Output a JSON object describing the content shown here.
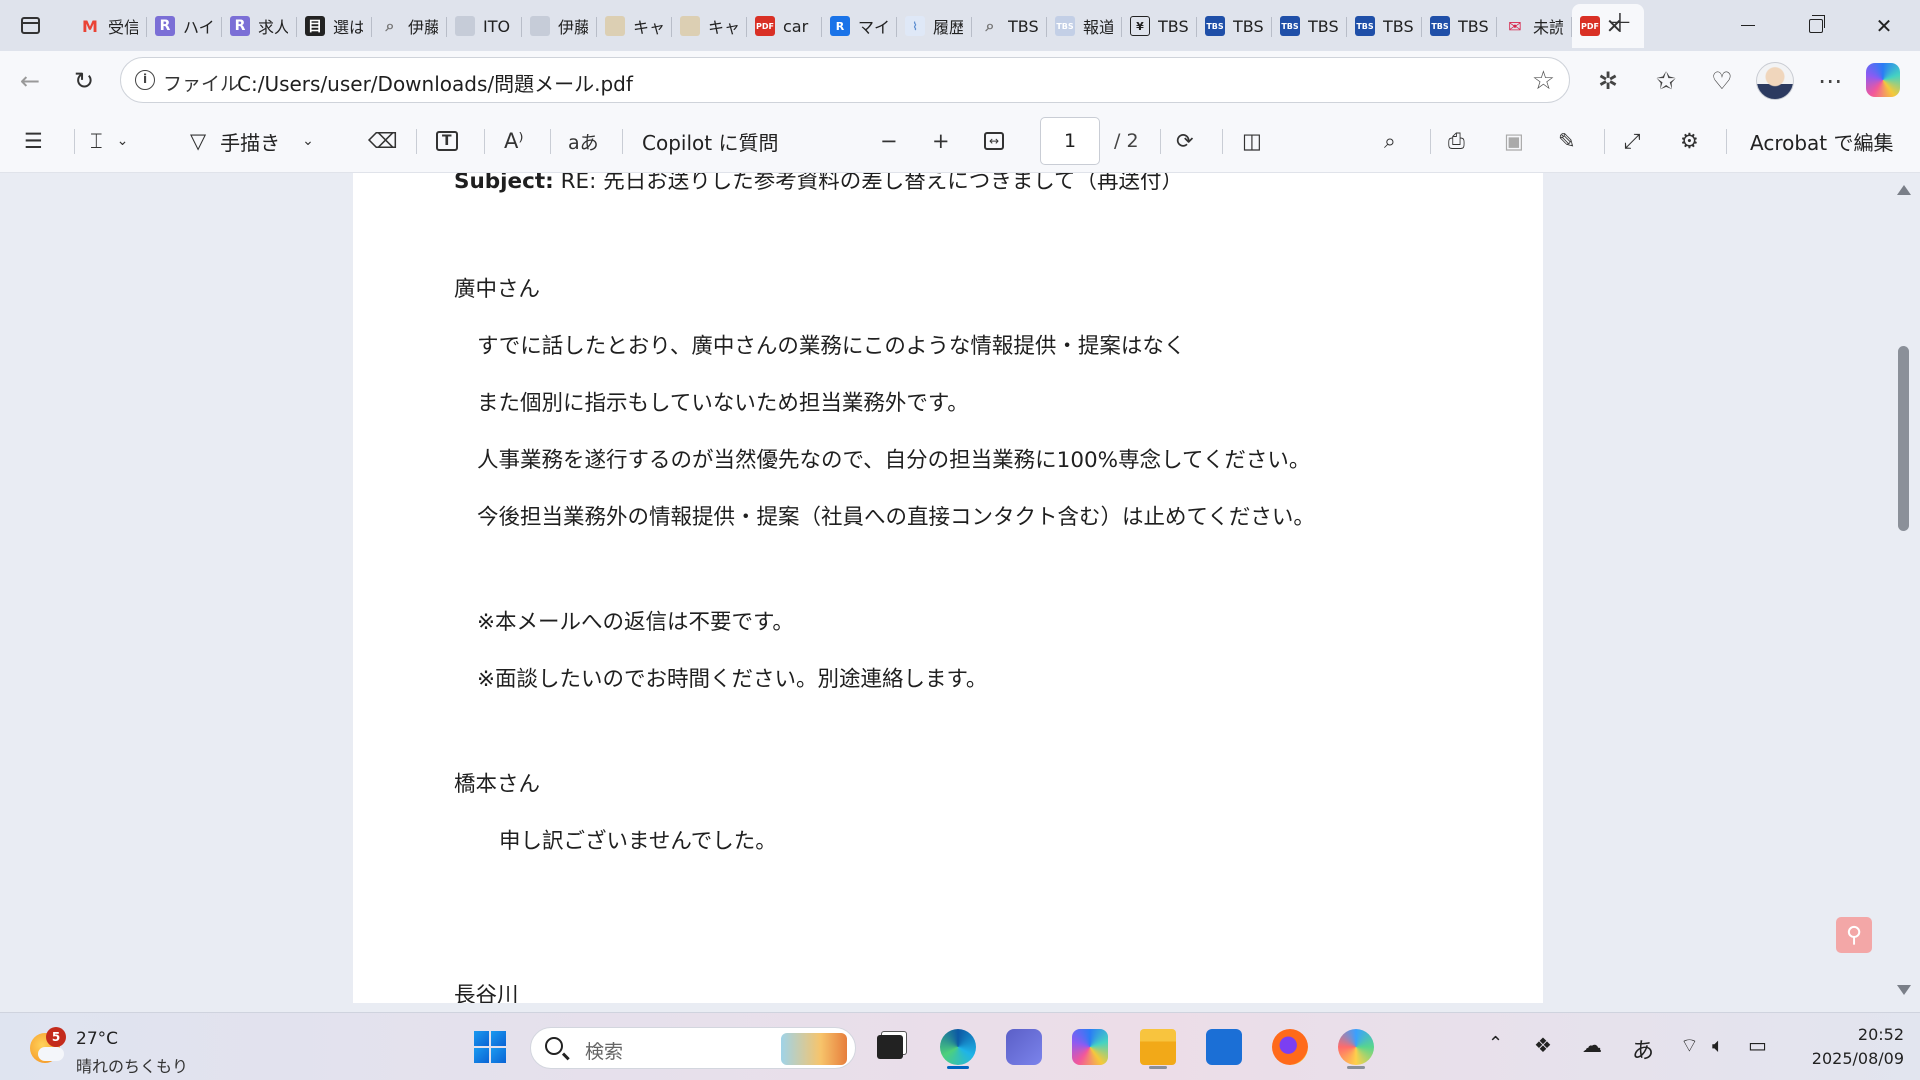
{
  "browser": {
    "tabs": [
      {
        "title": "受信",
        "icon": "gmail-icon",
        "color": "#ea4335"
      },
      {
        "title": "ハイ",
        "icon": "r-logo-icon",
        "color": "#7b6fd6"
      },
      {
        "title": "求人",
        "icon": "r-logo-icon",
        "color": "#7b6fd6"
      },
      {
        "title": "選は",
        "icon": "document-icon",
        "color": "#222222"
      },
      {
        "title": "伊藤",
        "icon": "search-icon",
        "color": "#777777"
      },
      {
        "title": "ITO",
        "icon": "site-icon",
        "color": "#9aa3b5"
      },
      {
        "title": "伊藤",
        "icon": "site-icon",
        "color": "#9aa3b5"
      },
      {
        "title": "キャ",
        "icon": "site-icon",
        "color": "#c9b48a"
      },
      {
        "title": "キャ",
        "icon": "site-icon",
        "color": "#c9b48a"
      },
      {
        "title": "car",
        "icon": "pdf-icon",
        "color": "#d93025"
      },
      {
        "title": "マイ",
        "icon": "re-logo-icon",
        "color": "#1a73e8"
      },
      {
        "title": "履歴",
        "icon": "chart-icon",
        "color": "#5f8fd1"
      },
      {
        "title": "TBS",
        "icon": "search-icon",
        "color": "#777777"
      },
      {
        "title": "報道",
        "icon": "tbs-icon",
        "color": "#9db1d8"
      },
      {
        "title": "TBS",
        "icon": "download-doc-icon",
        "color": "#222222"
      },
      {
        "title": "TBS",
        "icon": "tbs-icon",
        "color": "#1f4fa8"
      },
      {
        "title": "TBS",
        "icon": "tbs-icon",
        "color": "#1f4fa8"
      },
      {
        "title": "TBS",
        "icon": "tbs-icon",
        "color": "#1f4fa8"
      },
      {
        "title": "TBS",
        "icon": "tbs-icon",
        "color": "#1f4fa8"
      },
      {
        "title": "未読",
        "icon": "mail-icon",
        "color": "#d6234a"
      }
    ],
    "active_tab_icon": "pdf-icon",
    "address": {
      "label": "ファイル",
      "url": "C:/Users/user/Downloads/問題メール.pdf"
    }
  },
  "pdf_toolbar": {
    "handwrite_label": "手描き",
    "copilot_label": "Copilot に質問",
    "page_current": "1",
    "page_total": "/ 2",
    "acrobat_label": "Acrobat で編集"
  },
  "document": {
    "subject_label": "Subject:",
    "subject_text": " RE: 先日お送りした参考資料の差し替えにつきまして（再送付）",
    "lines": [
      "廣中さん",
      "すでに話したとおり、廣中さんの業務にこのような情報提供・提案はなく",
      "また個別に指示もしていないため担当業務外です。",
      "人事業務を遂行するのが当然優先なので、自分の担当業務に100%専念してください。",
      "今後担当業務外の情報提供・提案（社員への直接コンタクト含む）は止めてください。",
      "※本メールへの返信は不要です。",
      "※面談したいのでお時間ください。別途連絡します。",
      "橋本さん",
      "申し訳ございませんでした。",
      "長谷川"
    ]
  },
  "taskbar": {
    "weather_temp": "27°C",
    "weather_desc": "晴れのちくもり",
    "weather_badge": "5",
    "search_placeholder": "検索",
    "ime_label": "あ",
    "time": "20:52",
    "date": "2025/08/09",
    "apps": [
      "windows-start",
      "task-view",
      "edge",
      "teams",
      "copilot",
      "file-explorer",
      "microsoft-store",
      "firefox",
      "paint"
    ]
  }
}
